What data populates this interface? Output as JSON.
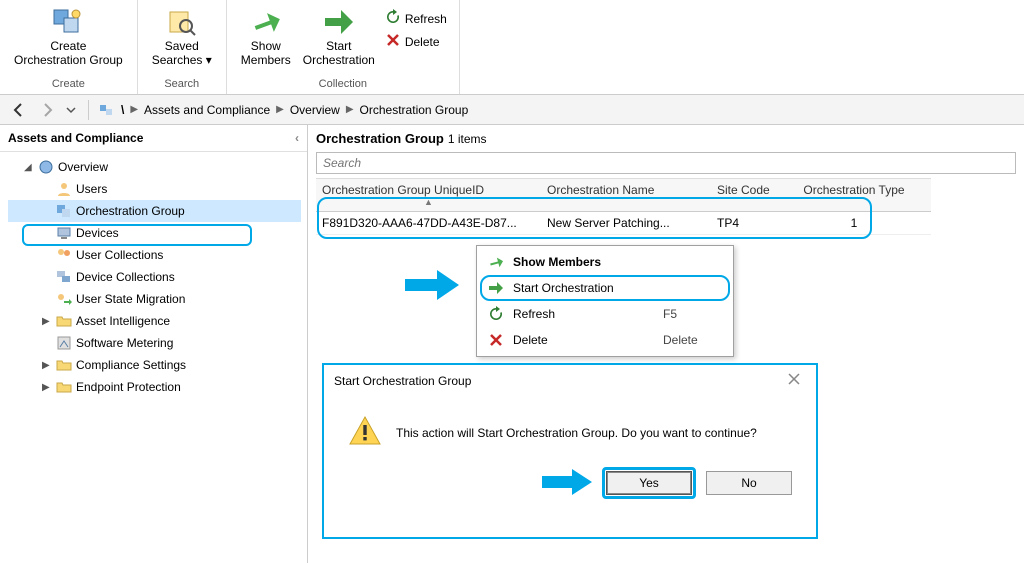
{
  "ribbon": {
    "groups": {
      "create": {
        "label": "Create",
        "create_orch_group": "Create\nOrchestration Group"
      },
      "search": {
        "label": "Search",
        "saved_searches": "Saved\nSearches ▾"
      },
      "collection": {
        "label": "Collection",
        "show_members": "Show\nMembers",
        "start_orchestration": "Start\nOrchestration",
        "refresh": "Refresh",
        "delete": "Delete"
      }
    }
  },
  "breadcrumb": {
    "root_sep": "\\",
    "items": [
      "Assets and Compliance",
      "Overview",
      "Orchestration Group"
    ]
  },
  "sidebar": {
    "title": "Assets and Compliance",
    "collapse_glyph": "‹",
    "nodes": {
      "overview": "Overview",
      "users": "Users",
      "orchestration_group": "Orchestration Group",
      "devices": "Devices",
      "user_collections": "User Collections",
      "device_collections": "Device Collections",
      "user_state_migration": "User State Migration",
      "asset_intelligence": "Asset Intelligence",
      "software_metering": "Software Metering",
      "compliance_settings": "Compliance Settings",
      "endpoint_protection": "Endpoint Protection"
    }
  },
  "content": {
    "title": "Orchestration Group",
    "item_count_text": "1 items",
    "search_placeholder": "Search",
    "columns": {
      "unique_id": "Orchestration Group UniqueID",
      "orch_name": "Orchestration Name",
      "site_code": "Site Code",
      "orch_type": "Orchestration Type"
    },
    "rows": [
      {
        "unique_id": "F891D320-AAA6-47DD-A43E-D87...",
        "orch_name": "New Server Patching...",
        "site_code": "TP4",
        "orch_type": "1"
      }
    ]
  },
  "context_menu": {
    "show_members": "Show Members",
    "start_orchestration": "Start Orchestration",
    "refresh": "Refresh",
    "refresh_accel": "F5",
    "delete": "Delete",
    "delete_accel": "Delete"
  },
  "dialog": {
    "title": "Start Orchestration Group",
    "message": "This action will Start Orchestration Group. Do you want to continue?",
    "yes": "Yes",
    "no": "No"
  }
}
